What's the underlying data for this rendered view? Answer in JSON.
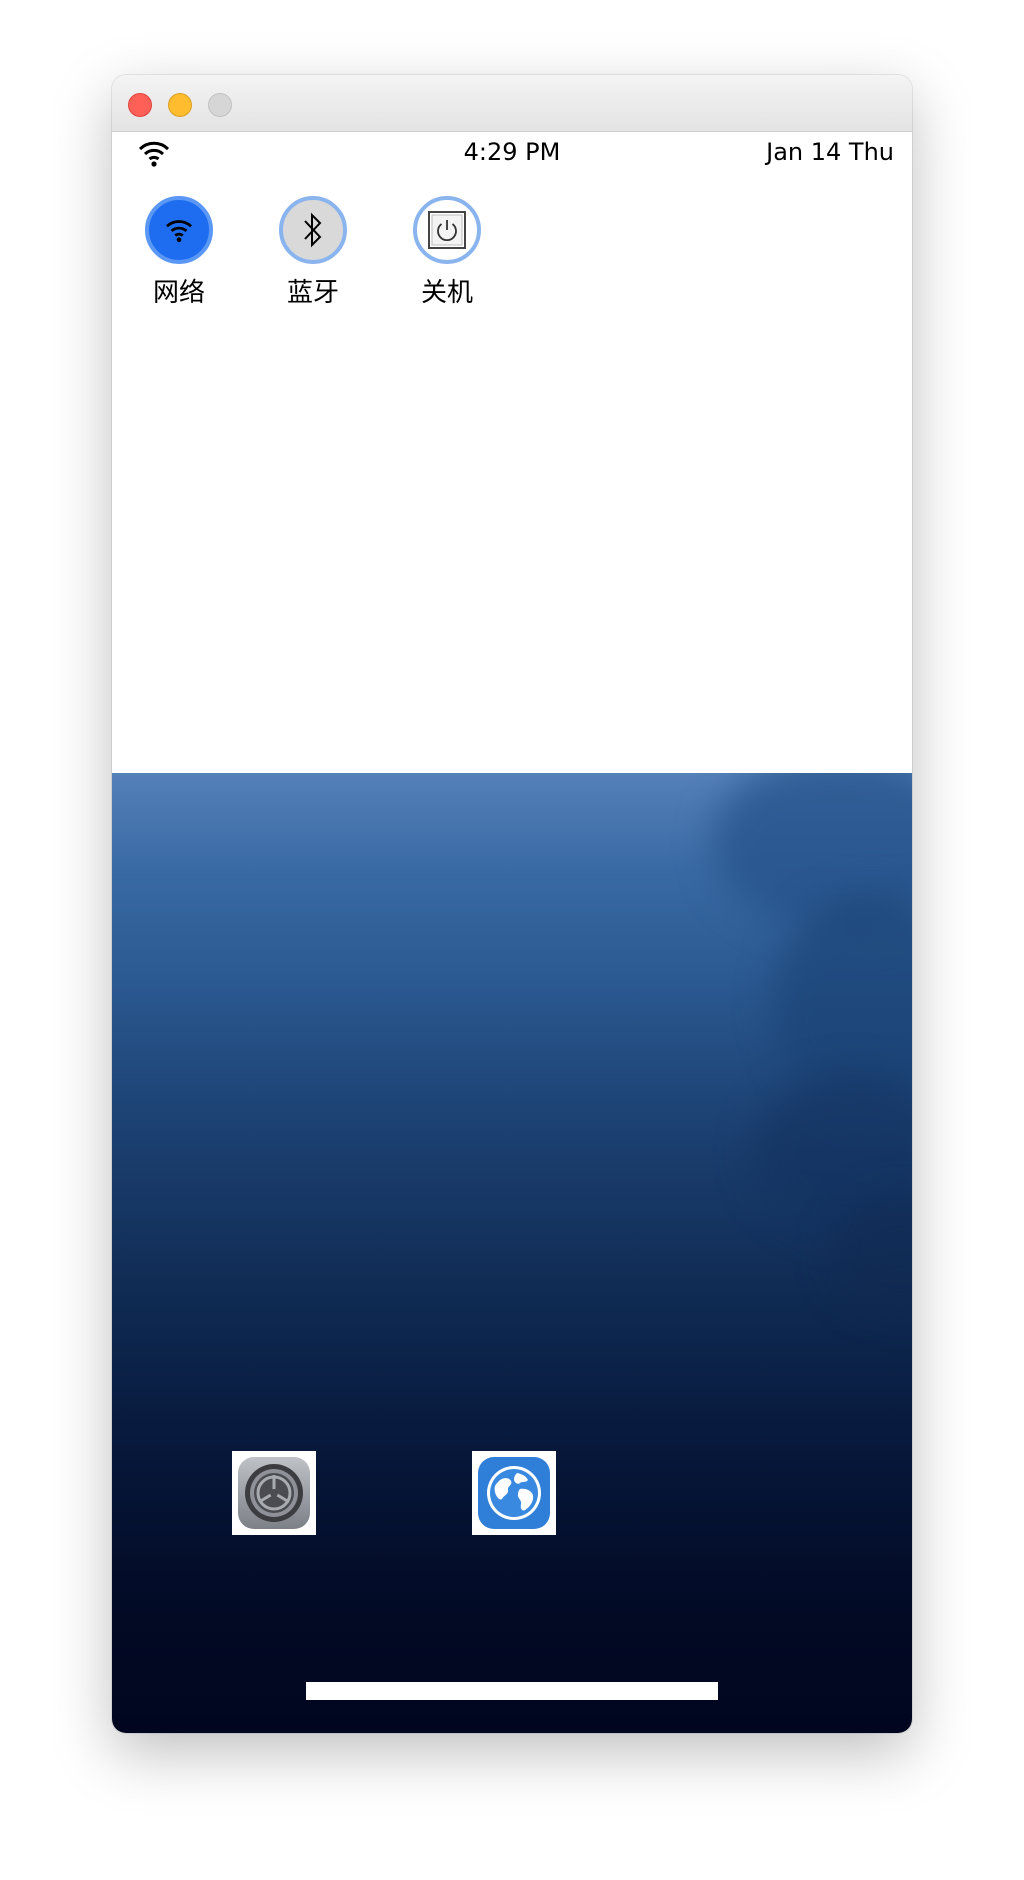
{
  "window": {
    "controls": [
      "close",
      "minimize",
      "zoom"
    ]
  },
  "status_bar": {
    "wifi_icon": "wifi-icon",
    "time": "4:29 PM",
    "date": "Jan 14 Thu"
  },
  "control_panel": {
    "toggles": [
      {
        "label": "网络",
        "icon": "wifi-icon",
        "state": "on"
      },
      {
        "label": "蓝牙",
        "icon": "bluetooth-icon",
        "state": "off"
      },
      {
        "label": "关机",
        "icon": "power-icon",
        "state": "action"
      }
    ]
  },
  "home_screen": {
    "apps": [
      {
        "icon": "settings-icon"
      },
      {
        "icon": "browser-globe-icon"
      }
    ]
  },
  "colors": {
    "toggle_active": "#1e6df0",
    "toggle_ring": "#8ab4ee",
    "wallpaper_top": "#5580b9",
    "wallpaper_bottom": "#010520"
  }
}
